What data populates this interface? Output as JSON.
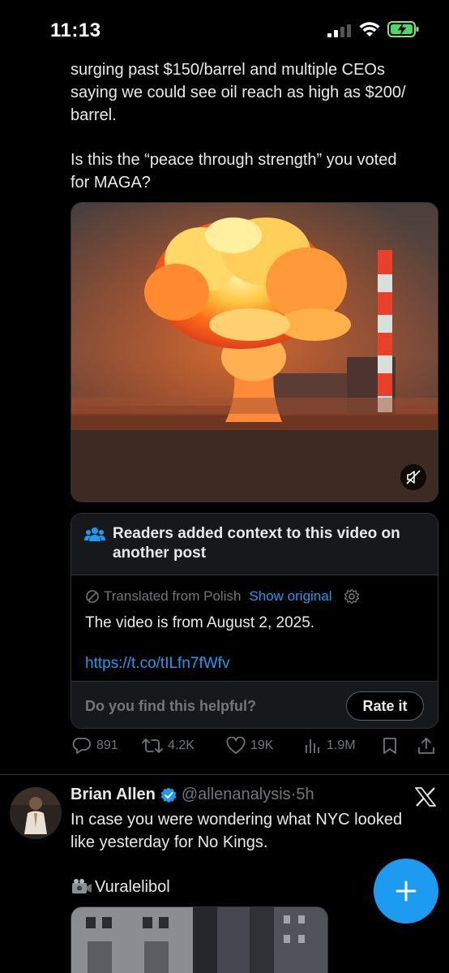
{
  "status_bar": {
    "time": "11:13"
  },
  "tweet": {
    "text_line_1": "surging past $150/barrel and multiple CEOs",
    "text_line_2": "saying we could see oil reach as high as $200/",
    "text_line_3": "barrel.",
    "text_para2_line_1": "Is this the “peace through strength” you voted",
    "text_para2_line_2": "for MAGA?",
    "video": {
      "icon": "mute-icon"
    },
    "community_note": {
      "title_line_1": "Readers added context to this video on",
      "title_line_2": "another post",
      "translated_label": "Translated from Polish",
      "show_original": "Show original",
      "body": "The video is from August 2, 2025.",
      "link": "https://t.co/tILfn7fWfv",
      "helpful_question": "Do you find this helpful?",
      "rate_button": "Rate it"
    },
    "actions": {
      "replies": "891",
      "reposts": "4.2K",
      "likes": "19K",
      "views": "1.9M"
    }
  },
  "next_tweet": {
    "author_name": "Brian Allen",
    "handle": "@allenanalysis",
    "separator": "·",
    "time": "5h",
    "text_line_1": "In case you were wondering what NYC looked",
    "text_line_2": "like yesterday for No Kings.",
    "credit": "Vuralelibol"
  },
  "colors": {
    "background": "#000000",
    "text": "#e7e9ea",
    "muted": "#71767b",
    "accent": "#1d9bf0"
  }
}
